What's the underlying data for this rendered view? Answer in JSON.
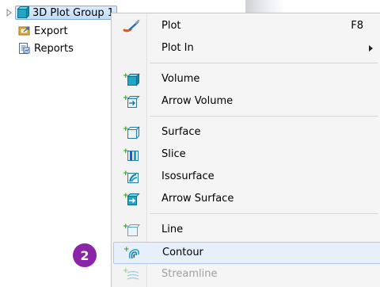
{
  "tree": {
    "items": [
      {
        "label": "3D Plot Group 1",
        "icon": "plot-group-icon",
        "selected": true
      },
      {
        "label": "Export",
        "icon": "export-icon"
      },
      {
        "label": "Reports",
        "icon": "reports-icon"
      }
    ]
  },
  "menu": {
    "plot": {
      "label": "Plot",
      "shortcut": "F8",
      "icon": "plot-brush-icon"
    },
    "plot_in": {
      "label": "Plot In",
      "has_submenu": true
    },
    "volume": {
      "label": "Volume",
      "icon": "volume-icon"
    },
    "arrow_volume": {
      "label": "Arrow Volume",
      "icon": "arrow-volume-icon"
    },
    "surface": {
      "label": "Surface",
      "icon": "surface-icon"
    },
    "slice": {
      "label": "Slice",
      "icon": "slice-icon"
    },
    "isosurface": {
      "label": "Isosurface",
      "icon": "isosurface-icon"
    },
    "arrow_surface": {
      "label": "Arrow Surface",
      "icon": "arrow-surface-icon"
    },
    "line": {
      "label": "Line",
      "icon": "line-icon"
    },
    "contour": {
      "label": "Contour",
      "icon": "contour-icon",
      "highlighted": true
    },
    "streamline": {
      "label": "Streamline",
      "icon": "streamline-icon",
      "disabled": true
    }
  },
  "badge": {
    "text": "2",
    "color": "#8a24a8"
  },
  "colors": {
    "accent": "#22a6c8",
    "plus": "#3a9a2a",
    "highlight": "#e6effa"
  }
}
